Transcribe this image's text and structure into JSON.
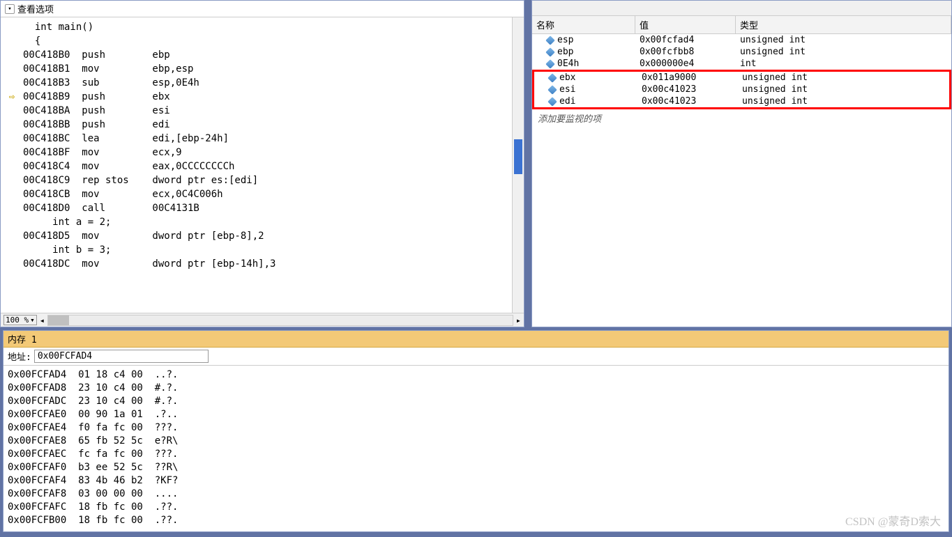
{
  "disasm": {
    "view_options_label": "查看选项",
    "zoom": "100 %",
    "lines": [
      {
        "gutter": "",
        "text": "  int main()"
      },
      {
        "gutter": "",
        "text": "  {"
      },
      {
        "gutter": "",
        "text": "00C418B0  push        ebp"
      },
      {
        "gutter": "",
        "text": "00C418B1  mov         ebp,esp"
      },
      {
        "gutter": "",
        "text": "00C418B3  sub         esp,0E4h"
      },
      {
        "gutter": "⇨",
        "text": "00C418B9  push        ebx"
      },
      {
        "gutter": "",
        "text": "00C418BA  push        esi"
      },
      {
        "gutter": "",
        "text": "00C418BB  push        edi"
      },
      {
        "gutter": "",
        "text": "00C418BC  lea         edi,[ebp-24h]"
      },
      {
        "gutter": "",
        "text": "00C418BF  mov         ecx,9"
      },
      {
        "gutter": "",
        "text": "00C418C4  mov         eax,0CCCCCCCCh"
      },
      {
        "gutter": "",
        "text": "00C418C9  rep stos    dword ptr es:[edi]"
      },
      {
        "gutter": "",
        "text": "00C418CB  mov         ecx,0C4C006h"
      },
      {
        "gutter": "",
        "text": "00C418D0  call        00C4131B"
      },
      {
        "gutter": "",
        "text": "     int a = 2;"
      },
      {
        "gutter": "",
        "text": "00C418D5  mov         dword ptr [ebp-8],2"
      },
      {
        "gutter": "",
        "text": ""
      },
      {
        "gutter": "",
        "text": "     int b = 3;"
      },
      {
        "gutter": "",
        "text": "00C418DC  mov         dword ptr [ebp-14h],3"
      }
    ]
  },
  "watch": {
    "headers": {
      "name": "名称",
      "value": "值",
      "type": "类型"
    },
    "add_watch_placeholder": "添加要监视的项",
    "rows": [
      {
        "name": "esp",
        "value": "0x00fcfad4",
        "type": "unsigned int",
        "hl": false
      },
      {
        "name": "ebp",
        "value": "0x00fcfbb8",
        "type": "unsigned int",
        "hl": false
      },
      {
        "name": "0E4h",
        "value": "0x000000e4",
        "type": "int",
        "hl": false
      },
      {
        "name": "ebx",
        "value": "0x011a9000",
        "type": "unsigned int",
        "hl": true
      },
      {
        "name": "esi",
        "value": "0x00c41023",
        "type": "unsigned int",
        "hl": true
      },
      {
        "name": "edi",
        "value": "0x00c41023",
        "type": "unsigned int",
        "hl": true
      }
    ]
  },
  "memory": {
    "title": "内存 1",
    "addr_label": "地址:",
    "addr_value": "0x00FCFAD4",
    "rows": [
      {
        "addr": "0x00FCFAD4",
        "hex": "01 18 c4 00",
        "ascii": "..?."
      },
      {
        "addr": "0x00FCFAD8",
        "hex": "23 10 c4 00",
        "ascii": "#.?."
      },
      {
        "addr": "0x00FCFADC",
        "hex": "23 10 c4 00",
        "ascii": "#.?."
      },
      {
        "addr": "0x00FCFAE0",
        "hex": "00 90 1a 01",
        "ascii": ".?.."
      },
      {
        "addr": "0x00FCFAE4",
        "hex": "f0 fa fc 00",
        "ascii": "???."
      },
      {
        "addr": "0x00FCFAE8",
        "hex": "65 fb 52 5c",
        "ascii": "e?R\\"
      },
      {
        "addr": "0x00FCFAEC",
        "hex": "fc fa fc 00",
        "ascii": "???."
      },
      {
        "addr": "0x00FCFAF0",
        "hex": "b3 ee 52 5c",
        "ascii": "??R\\"
      },
      {
        "addr": "0x00FCFAF4",
        "hex": "83 4b 46 b2",
        "ascii": "?KF?"
      },
      {
        "addr": "0x00FCFAF8",
        "hex": "03 00 00 00",
        "ascii": "...."
      },
      {
        "addr": "0x00FCFAFC",
        "hex": "18 fb fc 00",
        "ascii": ".??."
      },
      {
        "addr": "0x00FCFB00",
        "hex": "18 fb fc 00",
        "ascii": ".??."
      }
    ]
  },
  "watermark": "CSDN @蒙奇D索大"
}
